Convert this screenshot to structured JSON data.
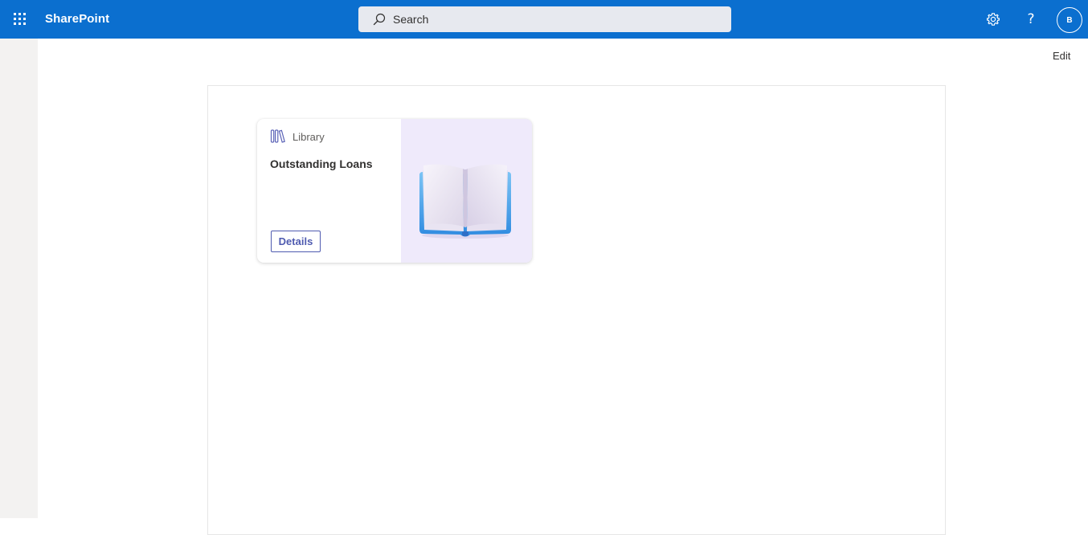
{
  "app": {
    "name": "SharePoint"
  },
  "search": {
    "placeholder": "Search"
  },
  "header": {
    "help_label": "?",
    "avatar_initial": "B"
  },
  "page": {
    "edit_label": "Edit"
  },
  "card": {
    "type_label": "Library",
    "title": "Outstanding Loans",
    "button_label": "Details",
    "icon": "library-icon",
    "illustration": "open-book"
  },
  "colors": {
    "suite_bar": "#0b6fcf",
    "card_accent": "#4f5bb0",
    "card_image_bg": "#efeafb"
  }
}
